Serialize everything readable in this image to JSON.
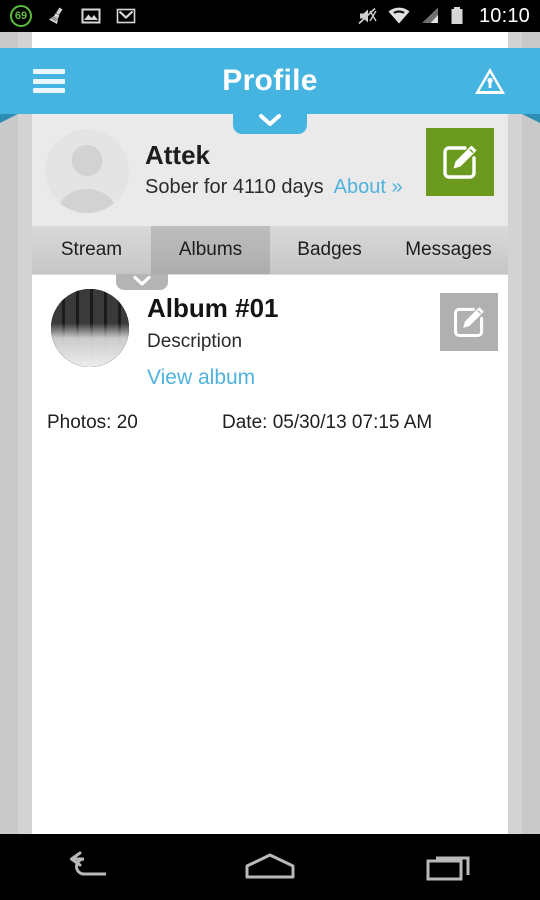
{
  "statusbar": {
    "left_icons": [
      {
        "name": "cleaner-badge-icon",
        "label": "69"
      },
      {
        "name": "broom-icon",
        "label": ""
      },
      {
        "name": "gallery-image-icon",
        "label": ""
      },
      {
        "name": "gmail-icon",
        "label": "M"
      }
    ],
    "right_icons": [
      {
        "name": "mute-icon",
        "label": ""
      },
      {
        "name": "wifi-icon",
        "label": ""
      },
      {
        "name": "cellular-signal-icon",
        "label": ""
      },
      {
        "name": "battery-icon",
        "label": ""
      }
    ],
    "clock": "10:10"
  },
  "appbar": {
    "menu_icon": "hamburger-menu-icon",
    "title": "Profile",
    "alert_icon": "warning-triangle-icon",
    "expand_icon": "chevron-down-icon"
  },
  "profile": {
    "avatar": "default-avatar-icon",
    "name": "Attek",
    "status": "Sober for 4110 days",
    "about_link": "About »",
    "edit_icon": "edit-pencil-icon",
    "edit_color": "#6b9a1e"
  },
  "tabs": {
    "items": [
      {
        "label": "Stream",
        "active": false
      },
      {
        "label": "Albums",
        "active": true
      },
      {
        "label": "Badges",
        "active": false
      },
      {
        "label": "Messages",
        "active": false
      }
    ],
    "expand_icon": "chevron-down-icon"
  },
  "albums": [
    {
      "thumbnail": "album-thumbnail-keyboard",
      "title": "Album #01",
      "description": "Description",
      "view_link": "View album",
      "edit_icon": "edit-pencil-icon",
      "photos_label": "Photos: 20",
      "date_label": "Date: 05/30/13 07:15 AM"
    }
  ],
  "navbar": {
    "back": "back-icon",
    "home": "home-icon",
    "recents": "recent-apps-icon"
  },
  "colors": {
    "accent": "#46b4e0",
    "link": "#4fb3dd",
    "edit_green": "#6b9a1e",
    "edit_gray": "#b0b0b0"
  }
}
